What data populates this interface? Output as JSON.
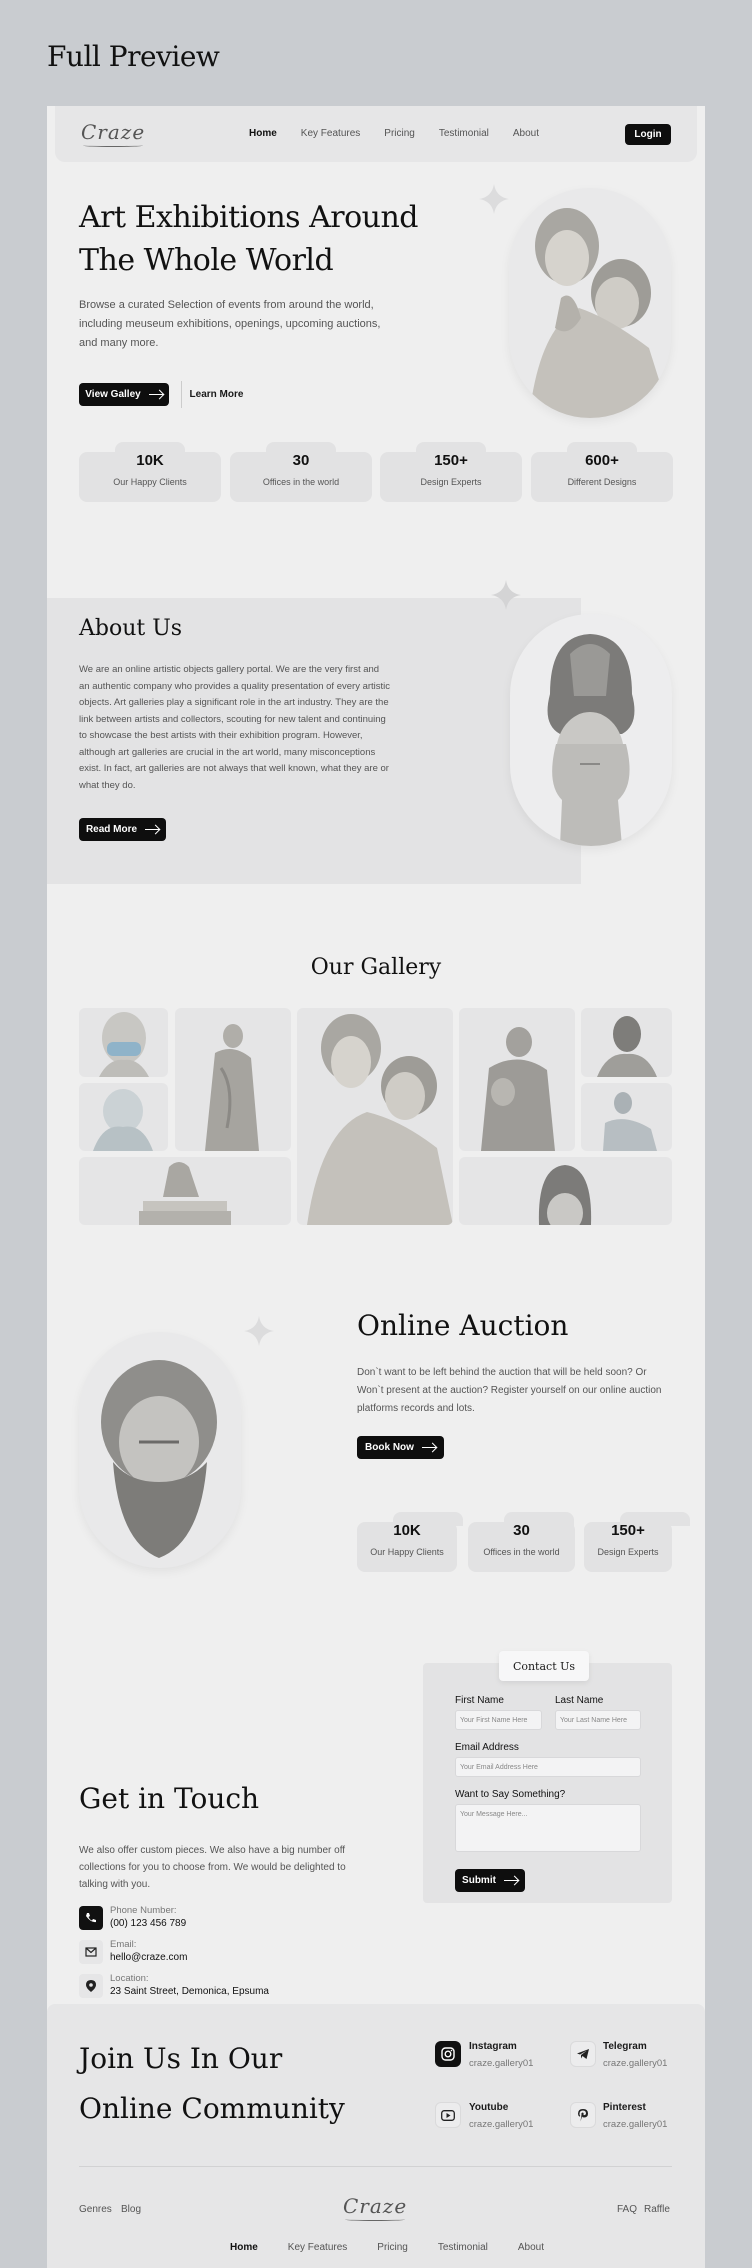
{
  "page_heading": "Full Preview",
  "nav": {
    "logo": "Craze",
    "links": [
      "Home",
      "Key Features",
      "Pricing",
      "Testimonial",
      "About"
    ],
    "login": "Login"
  },
  "hero": {
    "title_line1": "Art Exhibitions Around",
    "title_line2": "The Whole World",
    "description": "Browse a curated Selection of events from around the world, including meuseum exhibitions, openings, upcoming auctions, and many more.",
    "primary_button": "View Galley",
    "secondary_button": "Learn More",
    "stats": [
      {
        "value": "10K",
        "label": "Our Happy Clients"
      },
      {
        "value": "30",
        "label": "Offices in the world"
      },
      {
        "value": "150+",
        "label": "Design Experts"
      },
      {
        "value": "600+",
        "label": "Different Designs"
      }
    ]
  },
  "about": {
    "title": "About Us",
    "description": "We are an online artistic objects gallery portal. We are the very first and an authentic company who provides a quality presentation of every artistic objects. Art galleries play a significant role in the art industry. They are the link between artists and collectors, scouting for new talent and continuing to showcase the best artists with their exhibition program. However, although art galleries are crucial in the art world, many misconceptions exist. In fact, art galleries are not always that well known, what they are or what they do.",
    "button": "Read More"
  },
  "gallery": {
    "title": "Our Gallery"
  },
  "auction": {
    "title": "Online Auction",
    "description": "Don`t want to be left behind the auction that will be held soon? Or Won`t present at the auction? Register yourself on our online auction platforms records and lots.",
    "button": "Book Now",
    "stats": [
      {
        "value": "10K",
        "label": "Our Happy Clients"
      },
      {
        "value": "30",
        "label": "Offices in the world"
      },
      {
        "value": "150+",
        "label": "Design Experts"
      }
    ]
  },
  "contact": {
    "title": "Get in Touch",
    "description": "We also offer custom pieces. We also have a big number off collections for you to choose from. We would be delighted to talking with you.",
    "phone_label": "Phone Number:",
    "phone": "(00) 123 456 789",
    "email_label": "Email:",
    "email": "hello@craze.com",
    "location_label": "Location:",
    "location": "23 Saint Street, Demonica, Epsuma",
    "form": {
      "tab": "Contact Us",
      "first_name_label": "First Name",
      "first_name_placeholder": "Your First Name Here",
      "last_name_label": "Last Name",
      "last_name_placeholder": "Your Last Name Here",
      "email_label": "Email Address",
      "email_placeholder": "Your Email Address Here",
      "message_label": "Want to Say Something?",
      "message_placeholder": "Your Message Here...",
      "submit": "Submit"
    }
  },
  "community": {
    "title_line1": "Join Us In Our",
    "title_line2": "Online Community",
    "socials": [
      {
        "name": "Instagram",
        "handle": "craze.gallery01",
        "icon": "instagram-icon"
      },
      {
        "name": "Telegram",
        "handle": "craze.gallery01",
        "icon": "telegram-icon"
      },
      {
        "name": "Youtube",
        "handle": "craze.gallery01",
        "icon": "youtube-icon"
      },
      {
        "name": "Pinterest",
        "handle": "craze.gallery01",
        "icon": "pinterest-icon"
      }
    ]
  },
  "footer": {
    "left_links": [
      "Genres",
      "Blog"
    ],
    "logo": "Craze",
    "right_links": [
      "FAQ",
      "Raffle"
    ],
    "links": [
      "Home",
      "Key Features",
      "Pricing",
      "Testimonial",
      "About"
    ]
  },
  "colors": {
    "page_bg": "#c9ccd0",
    "frame_bg": "#efefef",
    "accent": "#0e0e0e"
  }
}
